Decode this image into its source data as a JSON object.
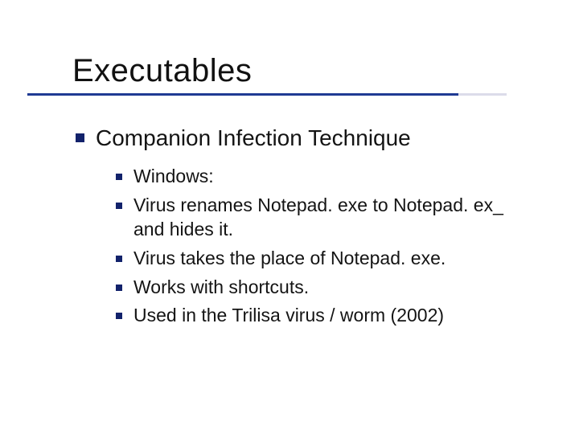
{
  "title": "Executables",
  "level1": {
    "text": "Companion Infection Technique"
  },
  "level2": [
    {
      "text": "Windows:"
    },
    {
      "text": "Virus renames Notepad. exe to Notepad. ex_ and hides it."
    },
    {
      "text": "Virus takes the place of Notepad. exe."
    },
    {
      "text": "Works with shortcuts."
    },
    {
      "text": "Used in the Trilisa virus / worm (2002)"
    }
  ]
}
